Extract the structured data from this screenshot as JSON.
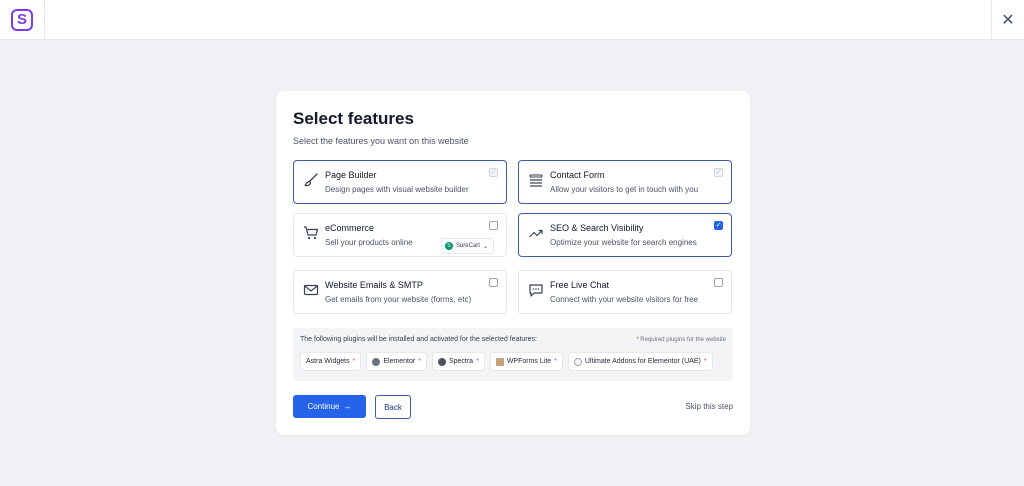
{
  "topbar": {
    "logo_letter": "S",
    "close_glyph": "✕"
  },
  "header": {
    "title": "Select features",
    "subtitle": "Select the features you want on this website"
  },
  "features": [
    {
      "title": "Page Builder",
      "desc": "Design pages with visual website builder",
      "icon": "paintbrush-icon",
      "checked": true,
      "locked": true
    },
    {
      "title": "Contact Form",
      "desc": "Allow your visitors to get in touch with you",
      "icon": "form-lines-icon",
      "checked": true,
      "locked": true
    },
    {
      "title": "eCommerce",
      "desc": "Sell your products online",
      "icon": "cart-icon",
      "checked": false,
      "locked": false,
      "platform": "SureCart"
    },
    {
      "title": "SEO & Search Visibility",
      "desc": "Optimize your website for search engines",
      "icon": "trend-up-icon",
      "checked": true,
      "locked": false
    },
    {
      "title": "Website Emails & SMTP",
      "desc": "Get emails from your website (forms, etc)",
      "icon": "envelope-icon",
      "checked": false,
      "locked": false
    },
    {
      "title": "Free Live Chat",
      "desc": "Connect with your website visitors for free",
      "icon": "chat-bubble-icon",
      "checked": false,
      "locked": false
    }
  ],
  "plugins": {
    "note": "The following plugins will be installed and activated for the selected features:",
    "required_note": "Required plugins for the website",
    "required_star": "*",
    "items": [
      {
        "name": "Astra Widgets",
        "required": true,
        "icon": "none"
      },
      {
        "name": "Elementor",
        "required": true,
        "icon": "elementor-icon"
      },
      {
        "name": "Spectra",
        "required": true,
        "icon": "spectra-icon"
      },
      {
        "name": "WPForms Lite",
        "required": true,
        "icon": "wpforms-icon"
      },
      {
        "name": "Ultimate Addons for Elementor (UAE)",
        "required": true,
        "icon": "uae-icon"
      }
    ]
  },
  "actions": {
    "continue_label": "Continue",
    "continue_arrow": "→",
    "back_label": "Back",
    "skip_label": "Skip this step"
  },
  "colors": {
    "accent": "#2563eb",
    "brand": "#7c3aed",
    "required": "#ef4444"
  }
}
